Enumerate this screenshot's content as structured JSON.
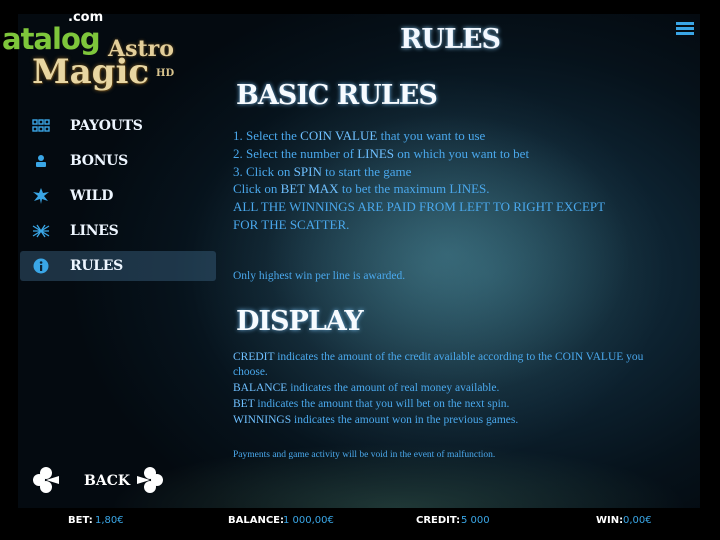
{
  "logo": {
    "site": "atalog",
    "site_tld": ".com",
    "game_title_1": "Astro",
    "game_title_2": "Magic",
    "game_badge": "HD"
  },
  "header": {
    "title": "RULES",
    "menu_icon": "hamburger-menu-icon"
  },
  "sidebar": {
    "items": [
      {
        "label": "PAYOUTS",
        "icon": "grid-icon",
        "active": false
      },
      {
        "label": "BONUS",
        "icon": "bonus-icon",
        "active": false
      },
      {
        "label": "WILD",
        "icon": "star-burst-icon",
        "active": false
      },
      {
        "label": "LINES",
        "icon": "lines-icon",
        "active": false
      },
      {
        "label": "RULES",
        "icon": "info-icon",
        "active": true
      }
    ]
  },
  "basic_rules": {
    "heading": "BASIC RULES",
    "lines": [
      {
        "pre": "1. Select the ",
        "key": "COIN VALUE",
        "post": " that you want to use"
      },
      {
        "pre": "2. Select the number of ",
        "key": "LINES",
        "post": " on which you want to bet"
      },
      {
        "pre": "3. Click on ",
        "key": "SPIN",
        "post": " to start the game"
      },
      {
        "pre": "Click on ",
        "key": "BET MAX",
        "post": " to bet the maximum LINES."
      },
      {
        "pre": "ALL THE WINNINGS ARE PAID FROM LEFT TO RIGHT EXCEPT",
        "key": "",
        "post": ""
      },
      {
        "pre": "FOR THE SCATTER.",
        "key": "",
        "post": ""
      }
    ],
    "note": "Only highest win per line is awarded."
  },
  "display": {
    "heading": "DISPLAY",
    "lines": [
      {
        "key": "CREDIT",
        "post": " indicates the amount of the credit available according to the COIN VALUE you"
      },
      {
        "key": "",
        "post": "choose."
      },
      {
        "key": "BALANCE",
        "post": " indicates the amount of real money available."
      },
      {
        "key": "BET",
        "post": " indicates the amount that you will bet on the next spin."
      },
      {
        "key": "WINNINGS",
        "post": " indicates the amount won in the previous games."
      }
    ],
    "disclaimer": "Payments and game activity will be void in the event of malfunction."
  },
  "nav": {
    "back_label": "BACK",
    "prev_icon": "clover-left-icon",
    "next_icon": "clover-right-icon"
  },
  "status": {
    "bet_label": "BET:",
    "bet_value": "1,80€",
    "balance_label": "BALANCE:",
    "balance_value": "1 000,00€",
    "credit_label": "CREDIT:",
    "credit_value": "5 000",
    "win_label": "WIN:",
    "win_value": "0,00€"
  },
  "colors": {
    "accent": "#3aa6e6",
    "text_blue": "#4aa8ec",
    "logo_green": "#7ec63b",
    "logo_gold": "#e8d6a2"
  }
}
